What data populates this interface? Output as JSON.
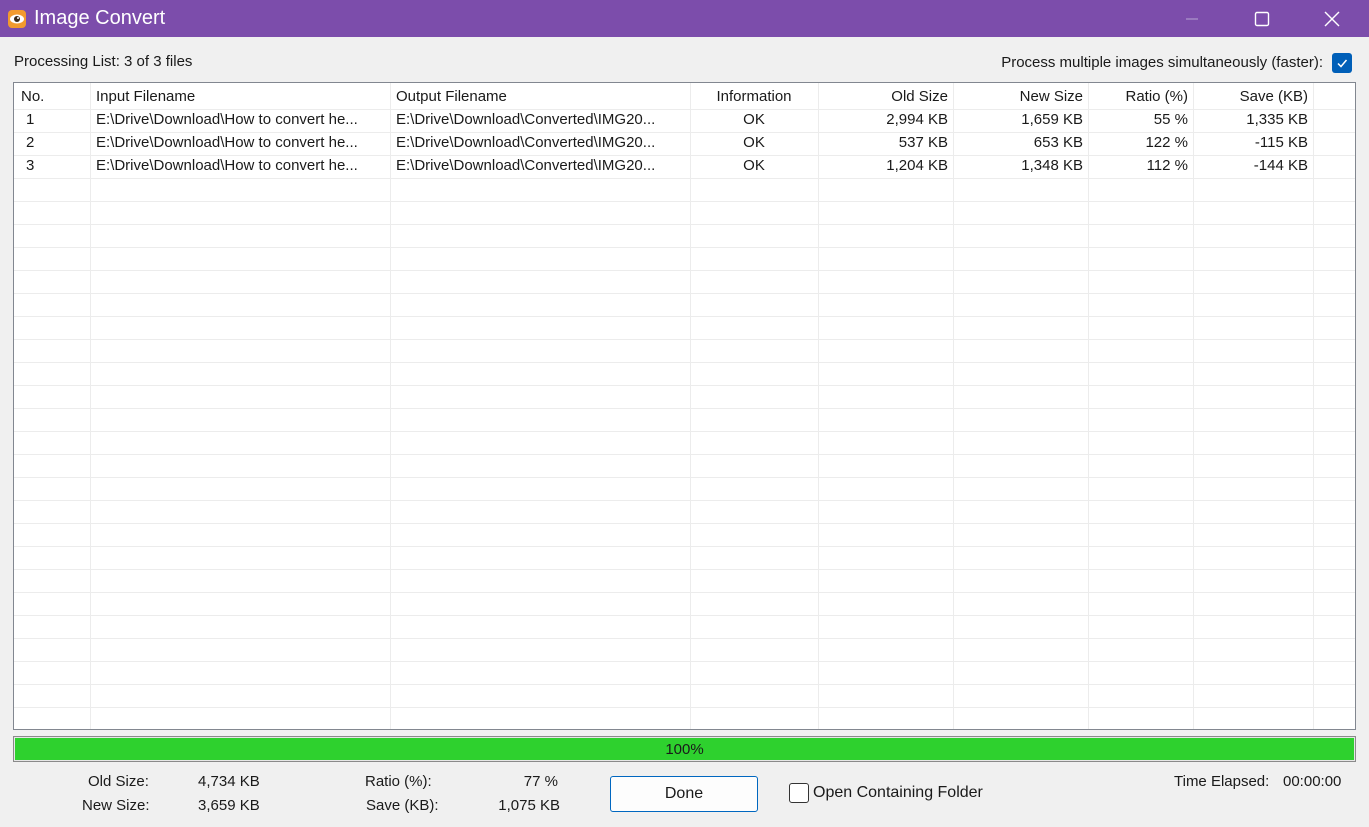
{
  "window": {
    "title": "Image Convert",
    "icon": "eye-app-icon",
    "titlebar_color": "#7c4dab"
  },
  "processing_list_label": "Processing List: 3 of 3 files",
  "multi_process": {
    "label": "Process multiple images simultaneously (faster):",
    "checked": true
  },
  "table": {
    "columns": [
      "No.",
      "Input Filename",
      "Output Filename",
      "Information",
      "Old Size",
      "New Size",
      "Ratio (%)",
      "Save (KB)"
    ],
    "rows": [
      [
        "1",
        "E:\\Drive\\Download\\How to convert he...",
        "E:\\Drive\\Download\\Converted\\IMG20...",
        "OK",
        "2,994 KB",
        "1,659 KB",
        "55 %",
        "1,335 KB"
      ],
      [
        "2",
        "E:\\Drive\\Download\\How to convert he...",
        "E:\\Drive\\Download\\Converted\\IMG20...",
        "OK",
        "537 KB",
        "653 KB",
        "122 %",
        "-115 KB"
      ],
      [
        "3",
        "E:\\Drive\\Download\\How to convert he...",
        "E:\\Drive\\Download\\Converted\\IMG20...",
        "OK",
        "1,204 KB",
        "1,348 KB",
        "112 %",
        "-144 KB"
      ]
    ]
  },
  "progress": {
    "text": "100%",
    "fraction": 1.0,
    "color": "#2ed12e"
  },
  "stats": {
    "old_size_label": "Old Size:",
    "old_size_value": "4,734 KB",
    "new_size_label": "New Size:",
    "new_size_value": "3,659 KB",
    "ratio_label": "Ratio (%):",
    "ratio_value": "77 %",
    "save_label": "Save (KB):",
    "save_value": "1,075 KB"
  },
  "done_button": "Done",
  "open_folder": {
    "label": "Open Containing Folder",
    "checked": false
  },
  "time_elapsed": {
    "label": "Time Elapsed:",
    "value": "00:00:00"
  }
}
